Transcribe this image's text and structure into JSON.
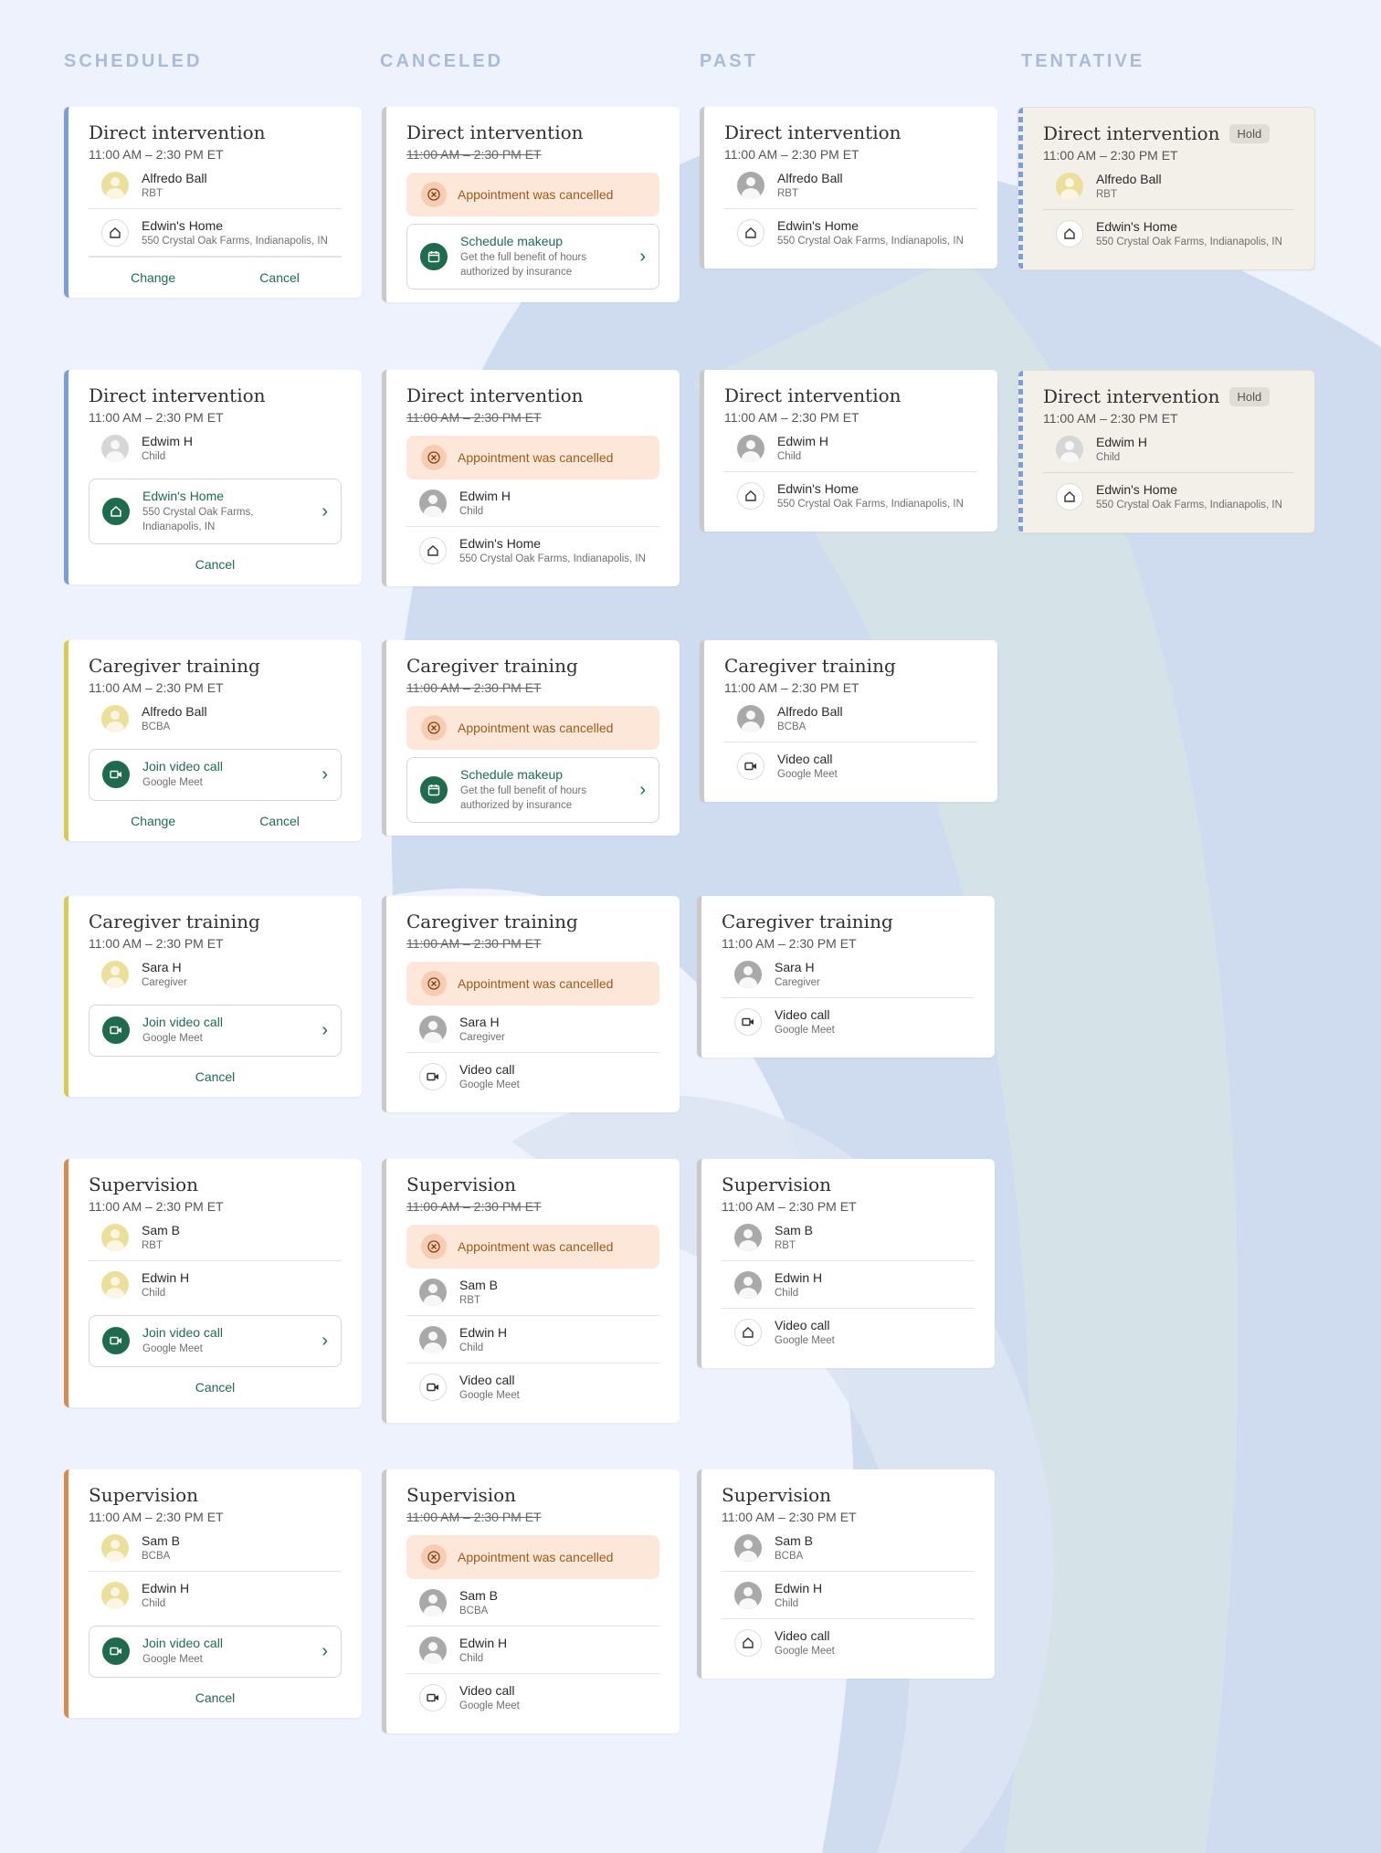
{
  "headers": {
    "scheduled": "SCHEDULED",
    "canceled": "CANCELED",
    "past": "PAST",
    "tentative": "TENTATIVE"
  },
  "common": {
    "time": "11:00 AM – 2:30 PM ET",
    "cancelled_banner": "Appointment was cancelled",
    "change": "Change",
    "cancel": "Cancel",
    "hold": "Hold",
    "makeup_title": "Schedule makeup",
    "makeup_sub": "Get the full benefit of hours authorized by insurance",
    "join_video": "Join video call",
    "video_call": "Video call",
    "google_meet": "Google Meet",
    "edwins_home": "Edwin's Home",
    "address": "550 Crystal Oak Farms, Indianapolis, IN",
    "address_line1": "550 Crystal Oak Farms,",
    "address_line2": "Indianapolis, IN"
  },
  "types": {
    "direct": "Direct intervention",
    "caregiver": "Caregiver training",
    "supervision": "Supervision"
  },
  "people": {
    "alfredo": "Alfredo Ball",
    "edwim": "Edwim H",
    "edwin": "Edwin H",
    "sara": "Sara H",
    "sam": "Sam B"
  },
  "roles": {
    "rbt": "RBT",
    "child": "Child",
    "bcba": "BCBA",
    "caregiver": "Caregiver"
  },
  "colors": {
    "background": "#eef2fc",
    "accent_green": "#1f6b4e",
    "scheduled_direct": "#7b9ed6",
    "scheduled_caregiver": "#d9cb52",
    "scheduled_supervision": "#d98b4f",
    "cancelled_banner": "#fde7d9"
  }
}
